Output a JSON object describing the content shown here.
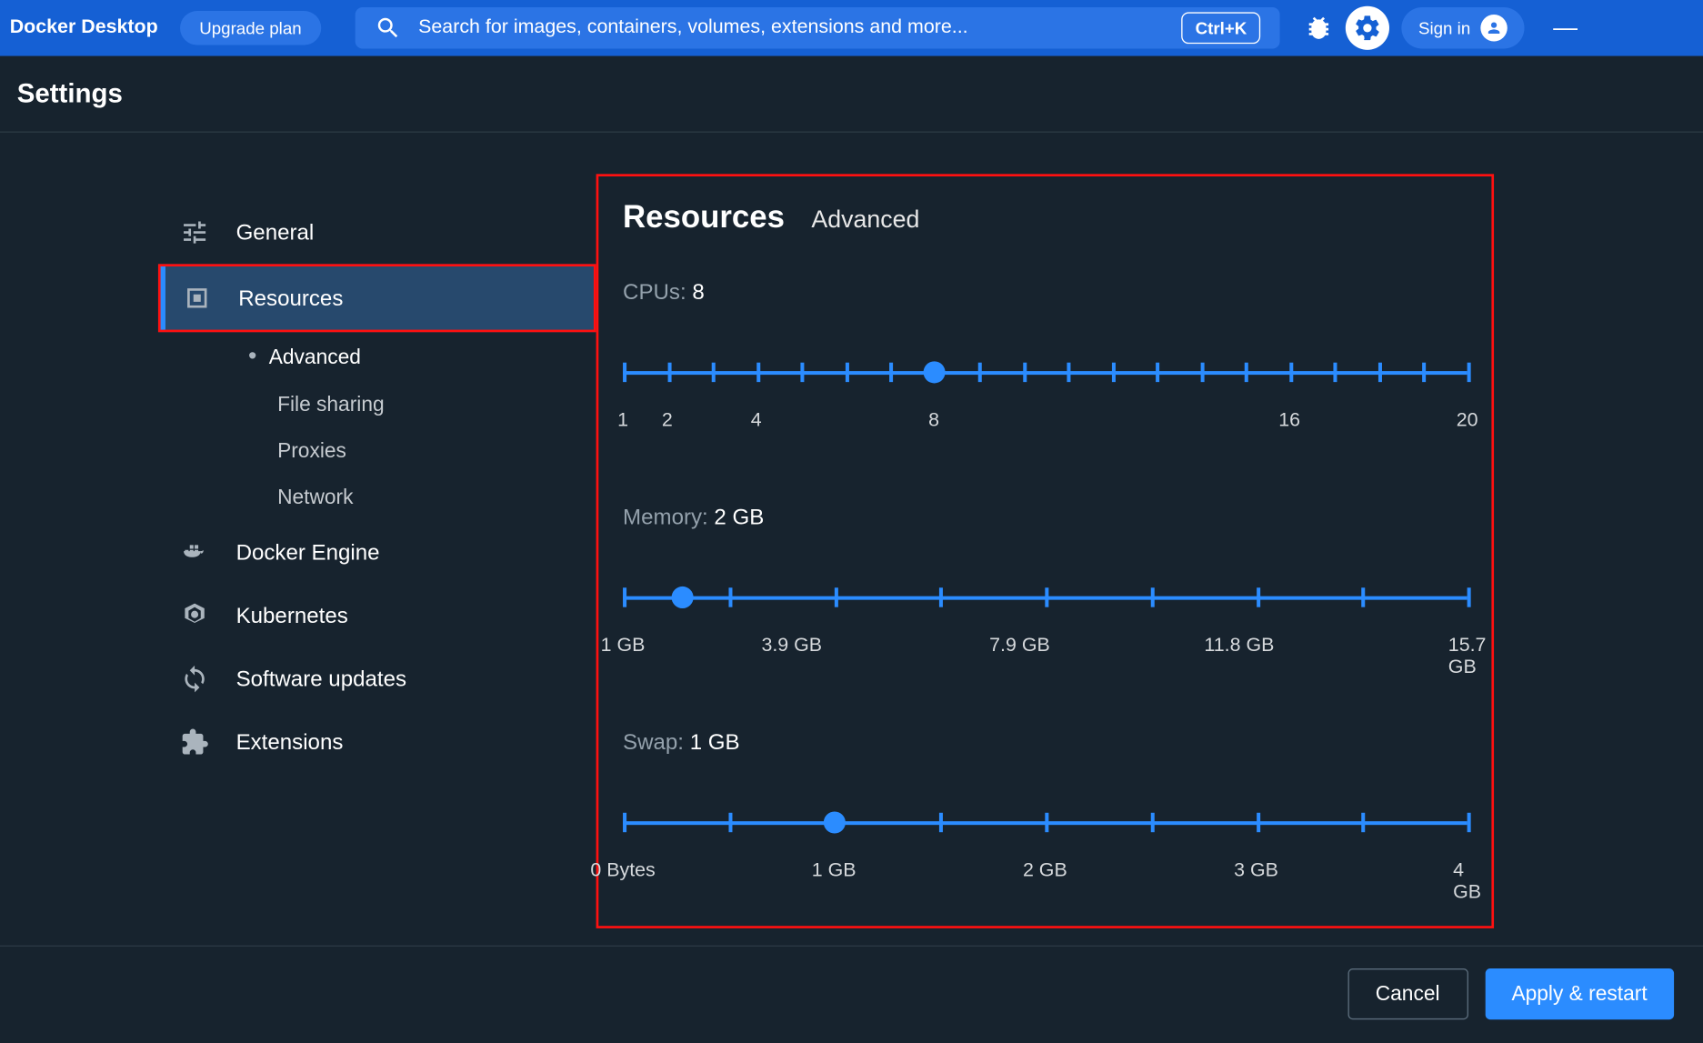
{
  "app_title": "Docker Desktop",
  "upgrade_label": "Upgrade plan",
  "search_placeholder": "Search for images, containers, volumes, extensions and more...",
  "search_shortcut": "Ctrl+K",
  "signin_label": "Sign in",
  "page_title": "Settings",
  "nav": {
    "general": "General",
    "resources": "Resources",
    "advanced": "Advanced",
    "file_sharing": "File sharing",
    "proxies": "Proxies",
    "network": "Network",
    "docker_engine": "Docker Engine",
    "kubernetes": "Kubernetes",
    "software_updates": "Software updates",
    "extensions": "Extensions"
  },
  "panel": {
    "title": "Resources",
    "subtitle": "Advanced"
  },
  "cpus": {
    "label_prefix": "CPUs: ",
    "value": "8",
    "ticks": [
      1,
      2,
      3,
      4,
      5,
      6,
      7,
      8,
      9,
      10,
      11,
      12,
      13,
      14,
      15,
      16,
      17,
      18,
      19,
      20
    ],
    "min": 1,
    "max": 20,
    "thumb": 8,
    "labels": [
      {
        "pos": 0,
        "text": "1"
      },
      {
        "pos": 5.26,
        "text": "2"
      },
      {
        "pos": 15.79,
        "text": "4"
      },
      {
        "pos": 36.84,
        "text": "8"
      },
      {
        "pos": 78.95,
        "text": "16"
      },
      {
        "pos": 100,
        "text": "20"
      }
    ]
  },
  "memory": {
    "label_prefix": "Memory: ",
    "value": "2 GB",
    "ticks_count": 9,
    "thumb_pct": 7,
    "labels": [
      {
        "pos": 0,
        "text": "1 GB"
      },
      {
        "pos": 20,
        "text": "3.9 GB"
      },
      {
        "pos": 47,
        "text": "7.9 GB"
      },
      {
        "pos": 73,
        "text": "11.8 GB"
      },
      {
        "pos": 100,
        "text": "15.7 GB"
      }
    ]
  },
  "swap": {
    "label_prefix": "Swap: ",
    "value": "1 GB",
    "ticks_count": 9,
    "thumb_pct": 25,
    "labels": [
      {
        "pos": 0,
        "text": "0 Bytes"
      },
      {
        "pos": 25,
        "text": "1 GB"
      },
      {
        "pos": 50,
        "text": "2 GB"
      },
      {
        "pos": 75,
        "text": "3 GB"
      },
      {
        "pos": 100,
        "text": "4 GB"
      }
    ]
  },
  "footer": {
    "cancel": "Cancel",
    "apply": "Apply & restart"
  }
}
